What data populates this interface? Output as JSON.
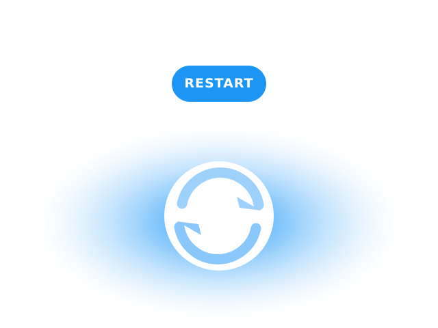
{
  "restart_button": {
    "label": "RESTART"
  },
  "refresh_control": {
    "icon": "refresh-icon"
  },
  "colors": {
    "button_background": "#1b96f7",
    "button_text": "#ffffff",
    "glow_center": "#5ab4fb",
    "glow_edge": "#ffffff",
    "icon_ring": "#ffffff",
    "arrow_top": "#9ed0fc",
    "arrow_bottom": "#8ac8fc"
  }
}
